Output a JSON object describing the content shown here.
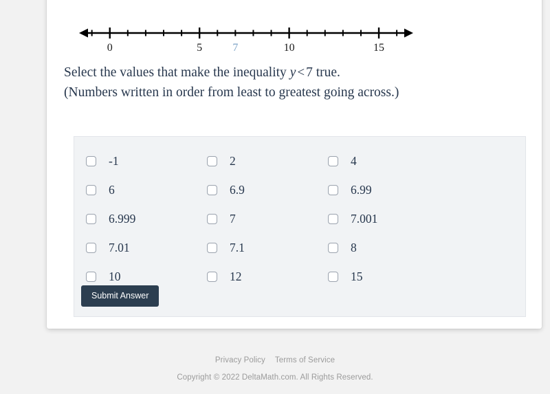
{
  "numberline": {
    "min": -1.6,
    "max": 16.8,
    "axis_color": "#000000",
    "tick_step": 1,
    "major_labels": [
      {
        "value": 0,
        "text": "0",
        "color": "#1a1a1a"
      },
      {
        "value": 5,
        "text": "5",
        "color": "#1a1a1a"
      },
      {
        "value": 7,
        "text": "7",
        "color": "#7ba2c6"
      },
      {
        "value": 10,
        "text": "10",
        "color": "#1a1a1a"
      },
      {
        "value": 15,
        "text": "15",
        "color": "#1a1a1a"
      }
    ]
  },
  "question": {
    "line1_before": "Select the values that make the inequality ",
    "line1_variable": "y",
    "line1_operator": "<",
    "line1_number": "7",
    "line1_after": " true.",
    "line2": "(Numbers written in order from least to greatest going across.)"
  },
  "choices": {
    "rows": [
      [
        {
          "label": "-1",
          "checked": false
        },
        {
          "label": "2",
          "checked": false
        },
        {
          "label": "4",
          "checked": false
        }
      ],
      [
        {
          "label": "6",
          "checked": false
        },
        {
          "label": "6.9",
          "checked": false
        },
        {
          "label": "6.99",
          "checked": false
        }
      ],
      [
        {
          "label": "6.999",
          "checked": false
        },
        {
          "label": "7",
          "checked": false
        },
        {
          "label": "7.001",
          "checked": false
        }
      ],
      [
        {
          "label": "7.01",
          "checked": false
        },
        {
          "label": "7.1",
          "checked": false
        },
        {
          "label": "8",
          "checked": false
        }
      ],
      [
        {
          "label": "10",
          "checked": false
        },
        {
          "label": "12",
          "checked": false
        },
        {
          "label": "15",
          "checked": false
        }
      ]
    ]
  },
  "submit": {
    "label": "Submit Answer",
    "background": "#2c3e50"
  },
  "footer": {
    "privacy_policy": "Privacy Policy",
    "terms_of_service": "Terms of Service",
    "copyright": "Copyright © 2022 DeltaMath.com. All Rights Reserved."
  }
}
